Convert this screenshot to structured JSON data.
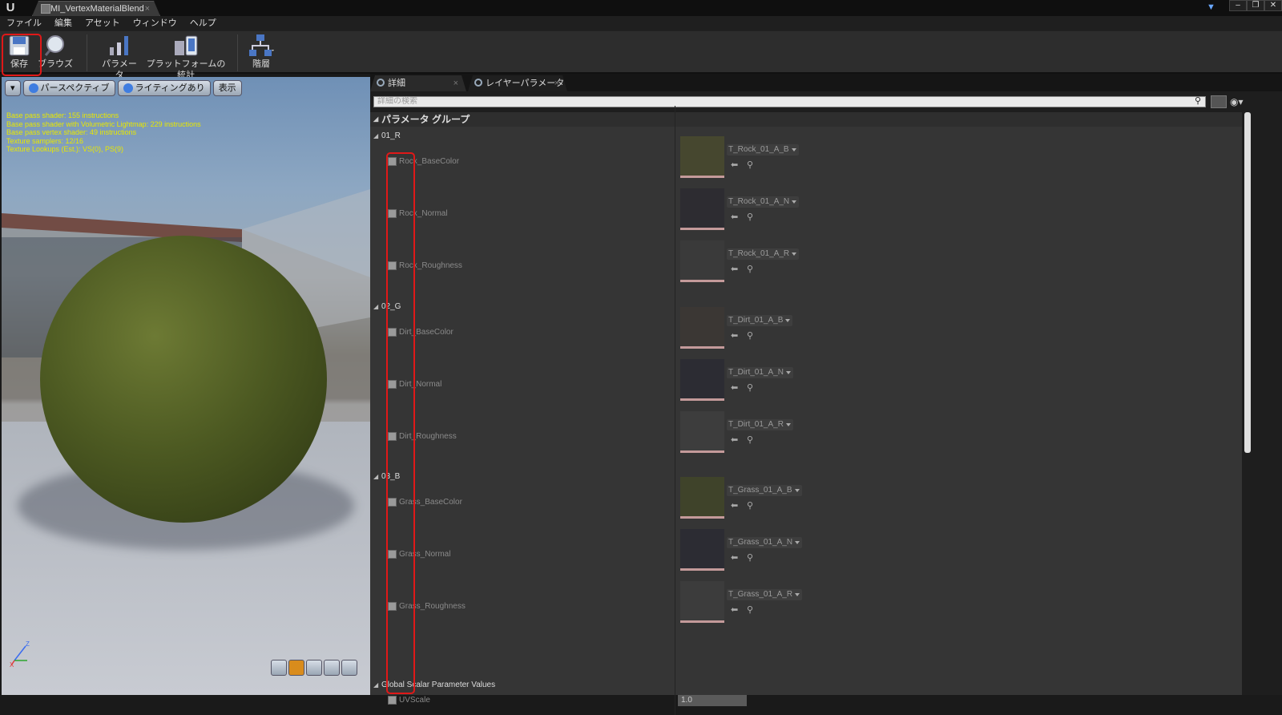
{
  "window": {
    "tab_title": "MI_VertexMaterialBlend",
    "close": "×",
    "controls": [
      "–",
      "❐",
      "✕"
    ]
  },
  "menu": [
    "ファイル",
    "編集",
    "アセット",
    "ウィンドウ",
    "ヘルプ"
  ],
  "toolbar": {
    "save": "保存",
    "browse": "ブラウズ",
    "params": "パラメータ",
    "platform_stats": "プラットフォームの統計",
    "hierarchy": "階層"
  },
  "viewport": {
    "perspective": "パースペクティブ",
    "lighting": "ライティングあり",
    "show": "表示",
    "stats": [
      "Base pass shader: 155 instructions",
      "Base pass shader with Volumetric Lightmap: 229 instructions",
      "Base pass vertex shader: 49 instructions",
      "Texture samplers: 12/16",
      "Texture Lookups (Est.): VS(0), PS(9)"
    ]
  },
  "details": {
    "tab_details": "詳細",
    "tab_layer_params": "レイヤーパラメータ",
    "search_placeholder": "詳細の検索",
    "category": "パラメータ グループ",
    "groups": [
      {
        "name": "01_R",
        "params": [
          {
            "name": "Rock_BaseColor",
            "texture": "T_Rock_01_A_B",
            "thumb_color": "#46472f"
          },
          {
            "name": "Rock_Normal",
            "texture": "T_Rock_01_A_N",
            "thumb_color": "#2d2c31"
          },
          {
            "name": "Rock_Roughness",
            "texture": "T_Rock_01_A_R",
            "thumb_color": "#3a3a3a"
          }
        ]
      },
      {
        "name": "02_G",
        "params": [
          {
            "name": "Dirt_BaseColor",
            "texture": "T_Dirt_01_A_B",
            "thumb_color": "#3b3734"
          },
          {
            "name": "Dirt_Normal",
            "texture": "T_Dirt_01_A_N",
            "thumb_color": "#2c2c33"
          },
          {
            "name": "Dirt_Roughness",
            "texture": "T_Dirt_01_A_R",
            "thumb_color": "#3d3d3d"
          }
        ]
      },
      {
        "name": "03_B",
        "params": [
          {
            "name": "Grass_BaseColor",
            "texture": "T_Grass_01_A_B",
            "thumb_color": "#3f432a"
          },
          {
            "name": "Grass_Normal",
            "texture": "T_Grass_01_A_N",
            "thumb_color": "#2c2c33"
          },
          {
            "name": "Grass_Roughness",
            "texture": "T_Grass_01_A_R",
            "thumb_color": "#3c3c3c"
          }
        ]
      }
    ],
    "global_group": "Global Scalar Parameter Values",
    "uv_param": "UVScale",
    "uv_value": "1.0"
  },
  "colors": {
    "highlight": "#e01818",
    "accent": "#d98c1c"
  }
}
